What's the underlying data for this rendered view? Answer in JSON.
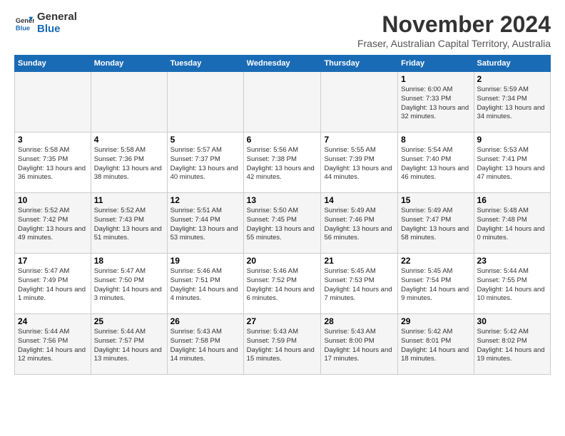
{
  "logo": {
    "line1": "General",
    "line2": "Blue"
  },
  "title": "November 2024",
  "subtitle": "Fraser, Australian Capital Territory, Australia",
  "days_header": [
    "Sunday",
    "Monday",
    "Tuesday",
    "Wednesday",
    "Thursday",
    "Friday",
    "Saturday"
  ],
  "weeks": [
    [
      {
        "day": "",
        "info": ""
      },
      {
        "day": "",
        "info": ""
      },
      {
        "day": "",
        "info": ""
      },
      {
        "day": "",
        "info": ""
      },
      {
        "day": "",
        "info": ""
      },
      {
        "day": "1",
        "info": "Sunrise: 6:00 AM\nSunset: 7:33 PM\nDaylight: 13 hours and 32 minutes."
      },
      {
        "day": "2",
        "info": "Sunrise: 5:59 AM\nSunset: 7:34 PM\nDaylight: 13 hours and 34 minutes."
      }
    ],
    [
      {
        "day": "3",
        "info": "Sunrise: 5:58 AM\nSunset: 7:35 PM\nDaylight: 13 hours and 36 minutes."
      },
      {
        "day": "4",
        "info": "Sunrise: 5:58 AM\nSunset: 7:36 PM\nDaylight: 13 hours and 38 minutes."
      },
      {
        "day": "5",
        "info": "Sunrise: 5:57 AM\nSunset: 7:37 PM\nDaylight: 13 hours and 40 minutes."
      },
      {
        "day": "6",
        "info": "Sunrise: 5:56 AM\nSunset: 7:38 PM\nDaylight: 13 hours and 42 minutes."
      },
      {
        "day": "7",
        "info": "Sunrise: 5:55 AM\nSunset: 7:39 PM\nDaylight: 13 hours and 44 minutes."
      },
      {
        "day": "8",
        "info": "Sunrise: 5:54 AM\nSunset: 7:40 PM\nDaylight: 13 hours and 46 minutes."
      },
      {
        "day": "9",
        "info": "Sunrise: 5:53 AM\nSunset: 7:41 PM\nDaylight: 13 hours and 47 minutes."
      }
    ],
    [
      {
        "day": "10",
        "info": "Sunrise: 5:52 AM\nSunset: 7:42 PM\nDaylight: 13 hours and 49 minutes."
      },
      {
        "day": "11",
        "info": "Sunrise: 5:52 AM\nSunset: 7:43 PM\nDaylight: 13 hours and 51 minutes."
      },
      {
        "day": "12",
        "info": "Sunrise: 5:51 AM\nSunset: 7:44 PM\nDaylight: 13 hours and 53 minutes."
      },
      {
        "day": "13",
        "info": "Sunrise: 5:50 AM\nSunset: 7:45 PM\nDaylight: 13 hours and 55 minutes."
      },
      {
        "day": "14",
        "info": "Sunrise: 5:49 AM\nSunset: 7:46 PM\nDaylight: 13 hours and 56 minutes."
      },
      {
        "day": "15",
        "info": "Sunrise: 5:49 AM\nSunset: 7:47 PM\nDaylight: 13 hours and 58 minutes."
      },
      {
        "day": "16",
        "info": "Sunrise: 5:48 AM\nSunset: 7:48 PM\nDaylight: 14 hours and 0 minutes."
      }
    ],
    [
      {
        "day": "17",
        "info": "Sunrise: 5:47 AM\nSunset: 7:49 PM\nDaylight: 14 hours and 1 minute."
      },
      {
        "day": "18",
        "info": "Sunrise: 5:47 AM\nSunset: 7:50 PM\nDaylight: 14 hours and 3 minutes."
      },
      {
        "day": "19",
        "info": "Sunrise: 5:46 AM\nSunset: 7:51 PM\nDaylight: 14 hours and 4 minutes."
      },
      {
        "day": "20",
        "info": "Sunrise: 5:46 AM\nSunset: 7:52 PM\nDaylight: 14 hours and 6 minutes."
      },
      {
        "day": "21",
        "info": "Sunrise: 5:45 AM\nSunset: 7:53 PM\nDaylight: 14 hours and 7 minutes."
      },
      {
        "day": "22",
        "info": "Sunrise: 5:45 AM\nSunset: 7:54 PM\nDaylight: 14 hours and 9 minutes."
      },
      {
        "day": "23",
        "info": "Sunrise: 5:44 AM\nSunset: 7:55 PM\nDaylight: 14 hours and 10 minutes."
      }
    ],
    [
      {
        "day": "24",
        "info": "Sunrise: 5:44 AM\nSunset: 7:56 PM\nDaylight: 14 hours and 12 minutes."
      },
      {
        "day": "25",
        "info": "Sunrise: 5:44 AM\nSunset: 7:57 PM\nDaylight: 14 hours and 13 minutes."
      },
      {
        "day": "26",
        "info": "Sunrise: 5:43 AM\nSunset: 7:58 PM\nDaylight: 14 hours and 14 minutes."
      },
      {
        "day": "27",
        "info": "Sunrise: 5:43 AM\nSunset: 7:59 PM\nDaylight: 14 hours and 15 minutes."
      },
      {
        "day": "28",
        "info": "Sunrise: 5:43 AM\nSunset: 8:00 PM\nDaylight: 14 hours and 17 minutes."
      },
      {
        "day": "29",
        "info": "Sunrise: 5:42 AM\nSunset: 8:01 PM\nDaylight: 14 hours and 18 minutes."
      },
      {
        "day": "30",
        "info": "Sunrise: 5:42 AM\nSunset: 8:02 PM\nDaylight: 14 hours and 19 minutes."
      }
    ]
  ]
}
